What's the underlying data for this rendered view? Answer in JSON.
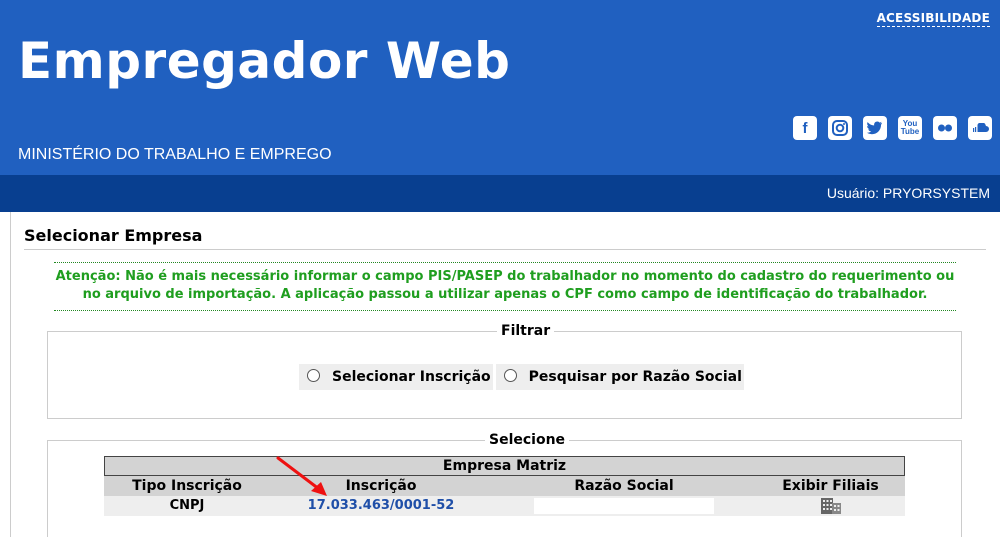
{
  "header": {
    "accessibility": "ACESSIBILIDADE",
    "app_title": "Empregador Web",
    "ministry": "MINISTÉRIO DO TRABALHO E EMPREGO",
    "social_icons": [
      "facebook-icon",
      "instagram-icon",
      "twitter-icon",
      "youtube-icon",
      "flickr-icon",
      "soundcloud-icon"
    ],
    "youtube_top": "You",
    "youtube_bottom": "Tube",
    "colors": {
      "header_blue": "#2060c0",
      "user_bar": "#083f90"
    }
  },
  "user_bar": {
    "text": "Usuário: PRYORSYSTEM"
  },
  "page": {
    "title": "Selecionar Empresa",
    "notice": "Atenção: Não é mais necessário informar o campo PIS/PASEP do trabalhador no momento do cadastro do requerimento ou no arquivo de importação. A aplicação passou a utilizar apenas o CPF como campo de identificação do trabalhador.",
    "notice_color": "#1f9e1f"
  },
  "filter": {
    "legend": "Filtrar",
    "options": [
      "Selecionar Inscrição",
      "Pesquisar por Razão Social"
    ]
  },
  "select": {
    "legend": "Selecione",
    "table": {
      "caption": "Empresa Matriz",
      "columns": [
        "Tipo Inscrição",
        "Inscrição",
        "Razão Social",
        "Exibir Filiais"
      ],
      "rows": [
        {
          "tipo": "CNPJ",
          "inscricao": "17.033.463/0001-52",
          "razao_social": "",
          "filiais_icon": "building-icon"
        }
      ]
    }
  },
  "annotation": {
    "arrow_color": "#ee1111"
  }
}
